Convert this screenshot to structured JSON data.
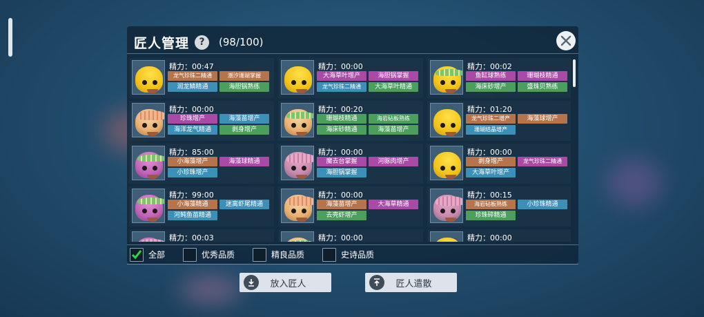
{
  "header": {
    "title": "匠人管理",
    "help_label": "?",
    "count": "(98/100)"
  },
  "cards": [
    {
      "power": "精力：00:47",
      "portrait": "yellow",
      "cap": "none",
      "tags": [
        {
          "text": "龙气珍珠二精通",
          "color": "orange",
          "small": true
        },
        {
          "text": "潮汐珊瑚掌握",
          "color": "orange",
          "small": true
        },
        {
          "text": "润龙鳞精通",
          "color": "blue"
        },
        {
          "text": "海胆锅熟练",
          "color": "green"
        }
      ]
    },
    {
      "power": "精力：00:00",
      "portrait": "yellow",
      "cap": "none",
      "tags": [
        {
          "text": "大海草叶增产",
          "color": "purple"
        },
        {
          "text": "海胆锅掌握",
          "color": "purple"
        },
        {
          "text": "龙气珍珠二精通",
          "color": "blue",
          "small": true
        },
        {
          "text": "大海草叶精通",
          "color": "green"
        }
      ]
    },
    {
      "power": "精力：00:02",
      "portrait": "yellow",
      "cap": "crown",
      "tags": [
        {
          "text": "鱼缸球熟练",
          "color": "purple"
        },
        {
          "text": "珊瑚枝精通",
          "color": "purple"
        },
        {
          "text": "海床砂增产",
          "color": "green"
        },
        {
          "text": "盛珠贝熟练",
          "color": "green"
        }
      ]
    },
    {
      "power": "精力：00:00",
      "portrait": "cream",
      "cap": "shell",
      "tags": [
        {
          "text": "珍珠增产",
          "color": "purple"
        },
        {
          "text": "海藻苗增产",
          "color": "blue"
        },
        {
          "text": "海洋龙气精通",
          "color": "blue"
        },
        {
          "text": "剥身增产",
          "color": "green"
        }
      ]
    },
    {
      "power": "精力：00:20",
      "portrait": "cream",
      "cap": "crown",
      "tags": [
        {
          "text": "珊瑚枝精通",
          "color": "green"
        },
        {
          "text": "海岩砧板熟练",
          "color": "green",
          "small": true
        },
        {
          "text": "海床砂精通",
          "color": "green"
        },
        {
          "text": "海藻苗增产",
          "color": "green"
        }
      ]
    },
    {
      "power": "精力：01:20",
      "portrait": "yellow",
      "cap": "none",
      "tags": [
        {
          "text": "龙气珍珠二增产",
          "color": "orange",
          "small": true
        },
        {
          "text": "海藻球增产",
          "color": "orange"
        },
        {
          "text": "珊瑚结晶增产",
          "color": "blue",
          "small": true
        }
      ]
    },
    {
      "power": "精力：85:00",
      "portrait": "purple",
      "cap": "crown",
      "tags": [
        {
          "text": "小海藻增产",
          "color": "orange"
        },
        {
          "text": "海藻球精通",
          "color": "purple"
        },
        {
          "text": "小珍珠增产",
          "color": "blue"
        }
      ]
    },
    {
      "power": "精力：00:00",
      "portrait": "pink",
      "cap": "pink",
      "tags": [
        {
          "text": "魔去台掌握",
          "color": "purple"
        },
        {
          "text": "河豚肉增产",
          "color": "purple"
        },
        {
          "text": "海胆锅掌握",
          "color": "blue"
        }
      ]
    },
    {
      "power": "精力：00:00",
      "portrait": "yellow",
      "cap": "none",
      "tags": [
        {
          "text": "剥身增产",
          "color": "orange"
        },
        {
          "text": "龙气珍珠二精通",
          "color": "purple",
          "small": true
        },
        {
          "text": "大海草叶增产",
          "color": "blue"
        }
      ]
    },
    {
      "power": "精力：99:00",
      "portrait": "purple",
      "cap": "crown",
      "tags": [
        {
          "text": "小海藻精通",
          "color": "orange"
        },
        {
          "text": "迷离虾尾精通",
          "color": "blue"
        },
        {
          "text": "河鲀鱼苗精通",
          "color": "blue"
        }
      ]
    },
    {
      "power": "精力：00:00",
      "portrait": "cream",
      "cap": "shell",
      "tags": [
        {
          "text": "海藻苗增产",
          "color": "orange"
        },
        {
          "text": "大海草精通",
          "color": "purple"
        },
        {
          "text": "去壳虾增产",
          "color": "green"
        }
      ]
    },
    {
      "power": "精力：00:15",
      "portrait": "pink",
      "cap": "pink",
      "tags": [
        {
          "text": "海岩砧板熟练",
          "color": "orange",
          "small": true
        },
        {
          "text": "小珍珠精通",
          "color": "blue"
        },
        {
          "text": "珍珠碎精通",
          "color": "green"
        }
      ]
    },
    {
      "power": "精力：00:03",
      "portrait": "purple",
      "cap": "pink",
      "tags": []
    },
    {
      "power": "精力：00:00",
      "portrait": "cream",
      "cap": "crown",
      "tags": []
    },
    {
      "power": "精力：00:00",
      "portrait": "yellow",
      "cap": "none",
      "tags": []
    }
  ],
  "filters": [
    {
      "label": "全部",
      "checked": true
    },
    {
      "label": "优秀品质",
      "checked": false
    },
    {
      "label": "精良品质",
      "checked": false
    },
    {
      "label": "史诗品质",
      "checked": false
    }
  ],
  "buttons": {
    "place": "放入匠人",
    "dismiss": "匠人遣散"
  }
}
